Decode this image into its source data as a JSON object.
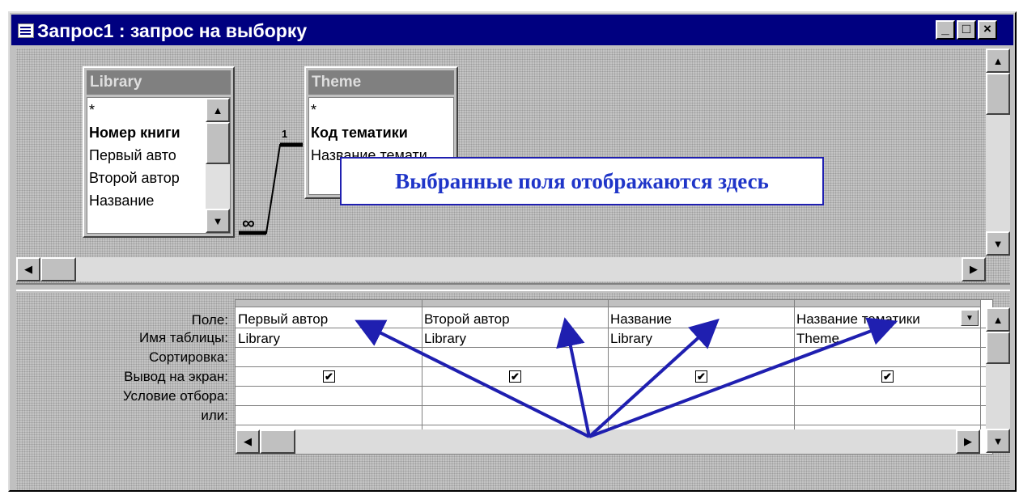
{
  "window": {
    "title": "Запрос1 : запрос на выборку",
    "controls": {
      "minimize": "_",
      "maximize": "□",
      "close": "×"
    }
  },
  "tables": [
    {
      "name": "Library",
      "fields": [
        "*",
        "Номер книги",
        "Первый авто",
        "Второй автор",
        "Название"
      ],
      "bold_field": "Номер книги"
    },
    {
      "name": "Theme",
      "fields": [
        "*",
        "Код тематики",
        "Название темати"
      ],
      "bold_field": "Код тематики"
    }
  ],
  "relationship": {
    "one_side": "1",
    "many_side": "∞"
  },
  "grid": {
    "row_labels": [
      "Поле:",
      "Имя таблицы:",
      "Сортировка:",
      "Вывод на экран:",
      "Условие отбора:",
      "или:"
    ],
    "columns": [
      {
        "field": "Первый автор",
        "table": "Library",
        "show": true
      },
      {
        "field": "Второй автор",
        "table": "Library",
        "show": true
      },
      {
        "field": "Название",
        "table": "Library",
        "show": true
      },
      {
        "field": "Название тематики",
        "table": "Theme",
        "show": true
      }
    ],
    "check_glyph": "✔"
  },
  "annotation": {
    "text": "Выбранные поля отображаются здесь",
    "color": "#1f35c8"
  },
  "icons": {
    "up": "▲",
    "down": "▼",
    "left": "◀",
    "right": "▶",
    "dropdown": "▼"
  }
}
